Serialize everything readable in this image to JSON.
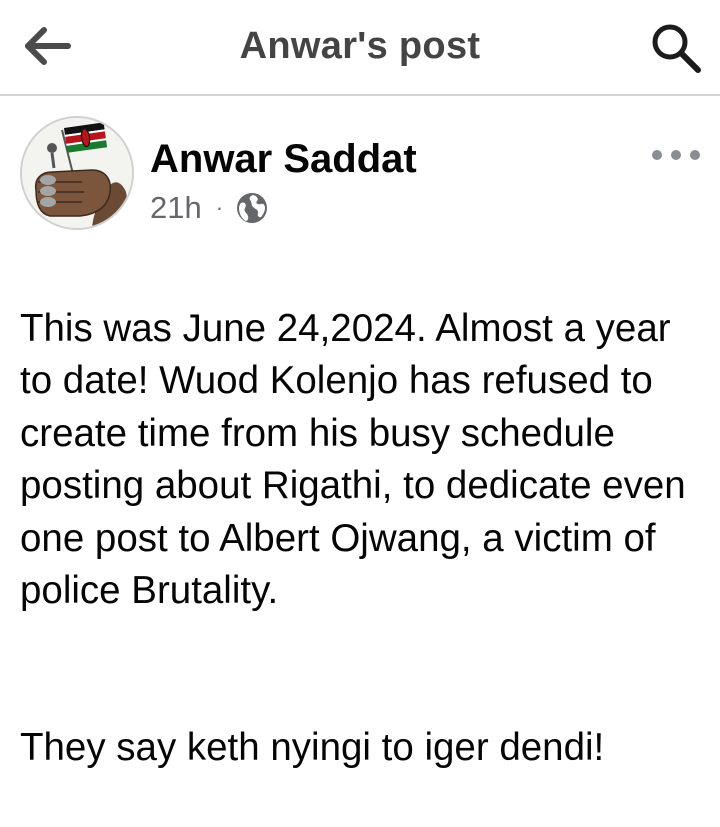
{
  "header": {
    "title": "Anwar's post",
    "back_icon": "arrow-left-icon",
    "search_icon": "search-icon"
  },
  "post": {
    "author": "Anwar Saddat",
    "time": "21h",
    "separator": "·",
    "privacy_icon": "globe-icon",
    "more_icon": "more-horizontal-icon",
    "paragraphs": [
      "This was June 24,2024. Almost a year to date! Wuod Kolenjo has refused to create time from his busy schedule posting about Rigathi, to dedicate even one post to Albert Ojwang, a victim of police Brutality.",
      "They say keth nyingi to iger dendi!"
    ]
  },
  "colors": {
    "title_text": "#444444",
    "body_text": "#050505",
    "meta_text": "#65676b",
    "divider": "#d4d4d4"
  }
}
